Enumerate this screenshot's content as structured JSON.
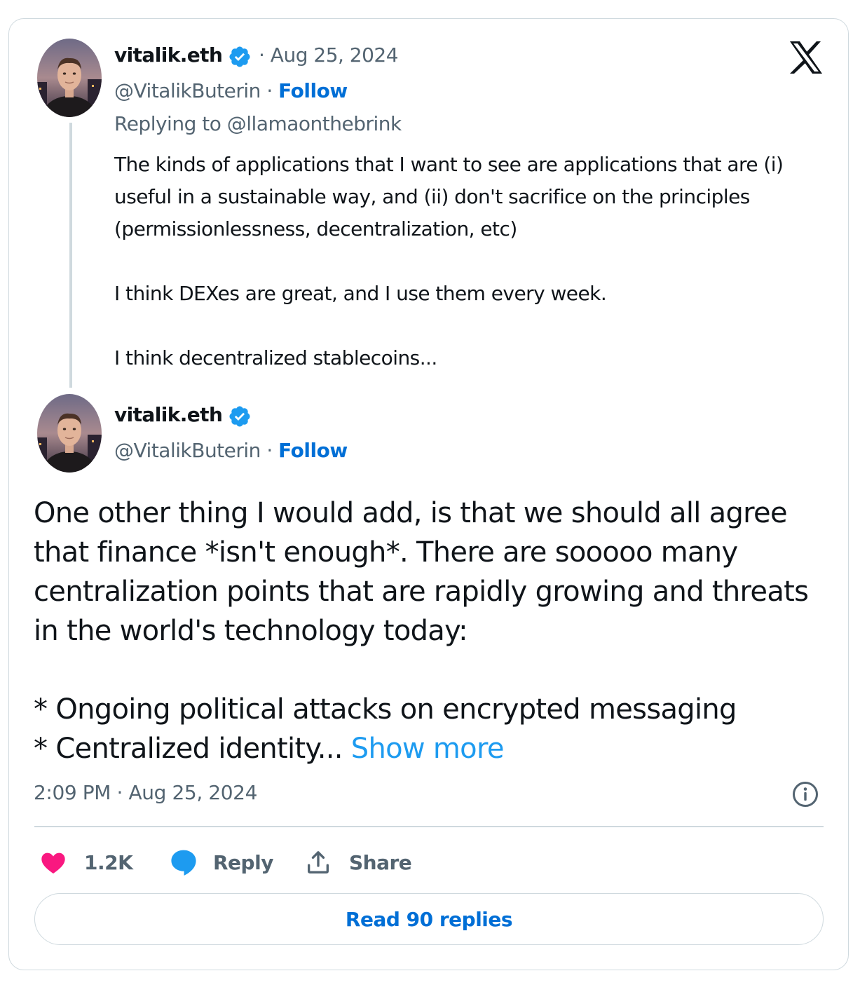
{
  "quoted_tweet": {
    "display_name": "vitalik.eth",
    "handle": "@VitalikButerin",
    "date": "· Aug 25, 2024",
    "follow_label": "Follow",
    "separator": "·",
    "replying_to": "Replying to @llamaonthebrink",
    "body_lines": [
      "The kinds of applications that I want to see are applications that are (i)",
      "useful in a sustainable way, and (ii) don't sacrifice on the principles",
      "(permissionlessness, decentralization, etc)",
      "",
      "I think DEXes are great, and I use them every week.",
      "",
      "I think decentralized stablecoins..."
    ]
  },
  "main_tweet": {
    "display_name": "vitalik.eth",
    "handle": "@VitalikButerin",
    "separator": "·",
    "follow_label": "Follow",
    "body_lines": [
      "One other thing I would add, is that we should all agree",
      "that finance *isn't enough*. There are sooooo many",
      "centralization points that are rapidly growing and threats",
      "in the world's technology today:",
      "",
      "* Ongoing political attacks on encrypted messaging"
    ],
    "last_line": "* Centralized identity... ",
    "show_more_label": "Show more",
    "timestamp": "2:09 PM · Aug 25, 2024"
  },
  "actions": {
    "like_count": "1.2K",
    "reply_label": "Reply",
    "share_label": "Share",
    "read_replies_label": "Read 90 replies"
  },
  "icons": {
    "logo": "x-logo-icon",
    "verified": "verified-badge-icon",
    "info": "info-icon",
    "like": "heart-icon",
    "reply": "speech-bubble-icon",
    "share": "share-upload-icon"
  },
  "colors": {
    "text": "#0f1419",
    "muted": "#536471",
    "follow": "#006fd6",
    "link": "#1d9bf0",
    "verified": "#1d9bf0",
    "like": "#f91880",
    "border": "#cfd9de"
  }
}
